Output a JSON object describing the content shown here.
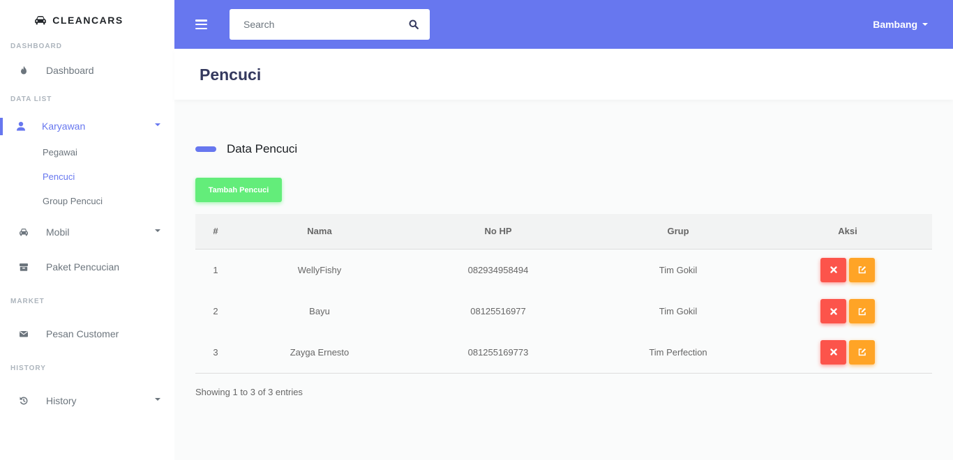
{
  "brand": {
    "name": "CLEANCARS",
    "icon": "car-icon"
  },
  "sidebar": {
    "sections": {
      "dashboard": "DASHBOARD",
      "data_list": "DATA LIST",
      "market": "MARKET",
      "history": "HISTORY"
    },
    "items": {
      "dashboard": {
        "label": "Dashboard",
        "icon": "fire-icon"
      },
      "karyawan": {
        "label": "Karyawan",
        "icon": "user-icon"
      },
      "pegawai": {
        "label": "Pegawai"
      },
      "pencuci": {
        "label": "Pencuci"
      },
      "group_pencuci": {
        "label": "Group Pencuci"
      },
      "mobil": {
        "label": "Mobil",
        "icon": "car-icon"
      },
      "paket": {
        "label": "Paket Pencucian",
        "icon": "box-icon"
      },
      "pesan": {
        "label": "Pesan Customer",
        "icon": "envelope-icon"
      },
      "history": {
        "label": "History",
        "icon": "history-icon"
      }
    },
    "active": "pencuci"
  },
  "navbar": {
    "search_placeholder": "Search",
    "search_value": "",
    "user_name": "Bambang"
  },
  "page": {
    "title": "Pencuci",
    "section_title": "Data Pencuci",
    "add_button": "Tambah Pencuci"
  },
  "table": {
    "headers": {
      "num": "#",
      "nama": "Nama",
      "hp": "No HP",
      "grup": "Grup",
      "aksi": "Aksi"
    },
    "rows": [
      {
        "num": "1",
        "nama": "WellyFishy",
        "hp": "082934958494",
        "grup": "Tim Gokil"
      },
      {
        "num": "2",
        "nama": "Bayu",
        "hp": "08125516977",
        "grup": "Tim Gokil"
      },
      {
        "num": "3",
        "nama": "Zayga Ernesto",
        "hp": "081255169773",
        "grup": "Tim Perfection"
      }
    ]
  },
  "footer": {
    "info": "Showing 1 to 3 of 3 entries"
  },
  "colors": {
    "primary": "#6777ef",
    "success": "#63ed7a",
    "danger": "#fc544b",
    "warning": "#ffa426"
  }
}
